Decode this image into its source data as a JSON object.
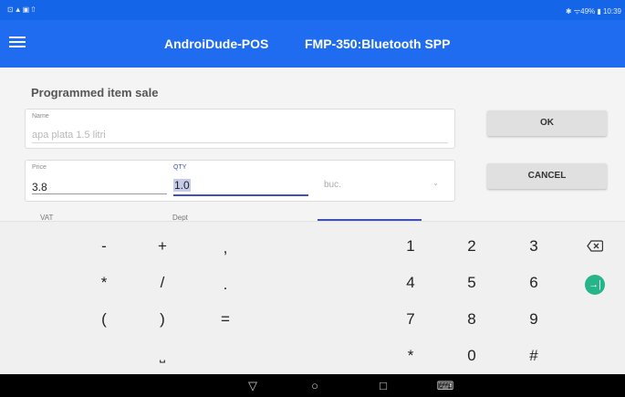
{
  "status_bar": {
    "left_icons": "⊡▲▣⇧",
    "right_text": "✱ ᯤ49% ▮ 10:39"
  },
  "app_bar": {
    "title": "AndroiDude-POS",
    "subtitle": "FMP-350:Bluetooth SPP",
    "menu_icon": "menu-icon",
    "color": "#1f6cf0"
  },
  "form": {
    "section_title": "Programmed item sale",
    "name": {
      "label": "Name",
      "value": "apa plata 1.5 litri"
    },
    "price": {
      "label": "Price",
      "value": "3.8"
    },
    "qty": {
      "label": "QTY",
      "value": "1.0"
    },
    "unit": {
      "value": "buc.",
      "icon": "dropdown-arrow-icon"
    },
    "vat": {
      "label": "VAT"
    },
    "dept": {
      "label": "Dept"
    }
  },
  "buttons": {
    "ok": "OK",
    "cancel": "CANCEL"
  },
  "keyboard": {
    "symbols": {
      "minus": "-",
      "plus": "+",
      "comma": ",",
      "asterisk": "*",
      "slash": "/",
      "period": ".",
      "open_paren": "(",
      "close_paren": ")",
      "equals": "=",
      "space": "⎵"
    },
    "digits": {
      "one": "1",
      "two": "2",
      "three": "3",
      "four": "4",
      "five": "5",
      "six": "6",
      "seven": "7",
      "eight": "8",
      "nine": "9",
      "star": "*",
      "zero": "0",
      "hash": "#"
    },
    "tab_glyph": "→|",
    "accent_color": "#26b589"
  },
  "nav_bar": {
    "back": "▽",
    "home": "○",
    "recents": "□",
    "keyboard": "⌨"
  }
}
